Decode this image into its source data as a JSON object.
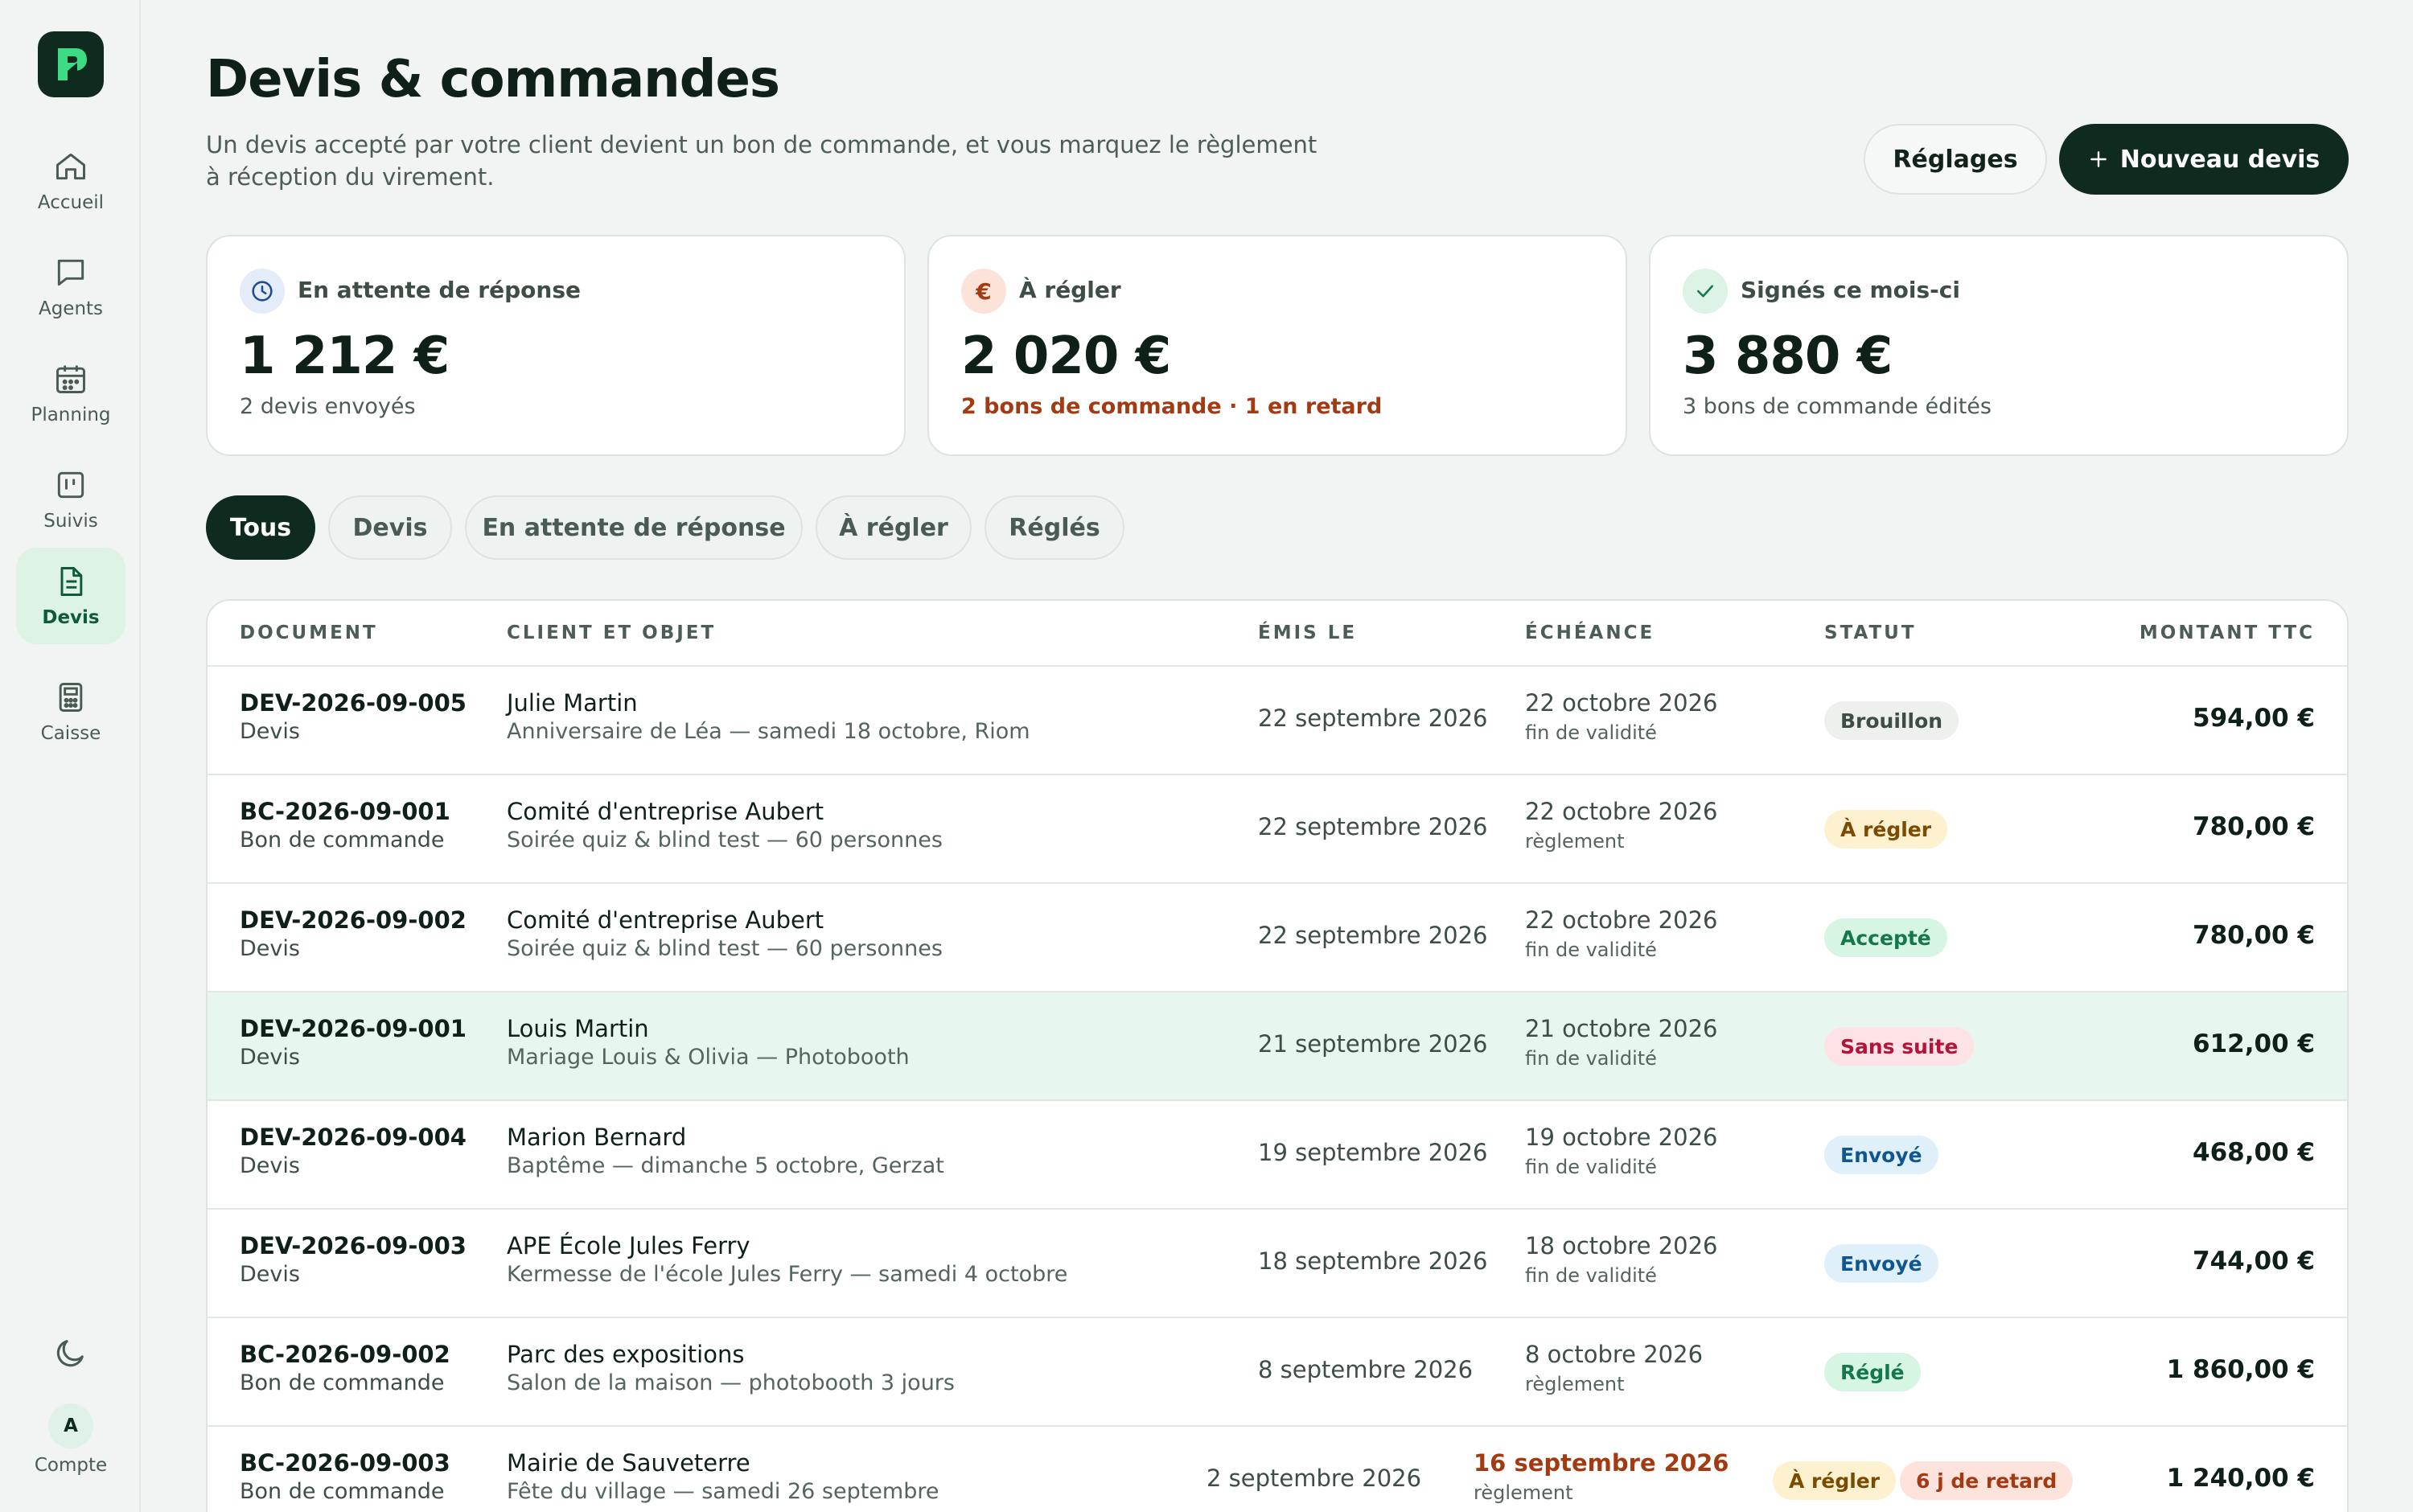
{
  "sidebar": {
    "items": [
      {
        "label": "Accueil",
        "icon": "home-icon"
      },
      {
        "label": "Agents",
        "icon": "chat-icon"
      },
      {
        "label": "Planning",
        "icon": "calendar-icon"
      },
      {
        "label": "Suivis",
        "icon": "kanban-icon"
      },
      {
        "label": "Devis",
        "icon": "document-icon",
        "active": true
      },
      {
        "label": "Caisse",
        "icon": "calculator-icon"
      }
    ],
    "account_initial": "A",
    "account_label": "Compte"
  },
  "header": {
    "title": "Devis & commandes",
    "subtitle": "Un devis accepté par votre client devient un bon de commande, et vous marquez le règlement à réception du virement.",
    "settings_label": "Réglages",
    "new_label": "Nouveau devis"
  },
  "cards": [
    {
      "label": "En attente de réponse",
      "value": "1 212 €",
      "note": "2 devis envoyés"
    },
    {
      "label": "À régler",
      "value": "2 020 €",
      "note": "2 bons de commande · 1 en retard"
    },
    {
      "label": "Signés ce mois-ci",
      "value": "3 880 €",
      "note": "3 bons de commande édités"
    }
  ],
  "filters": [
    "Tous",
    "Devis",
    "En attente de réponse",
    "À régler",
    "Réglés"
  ],
  "table": {
    "headers": [
      "DOCUMENT",
      "CLIENT ET OBJET",
      "ÉMIS LE",
      "ÉCHÉANCE",
      "STATUT",
      "MONTANT TTC"
    ],
    "rows": [
      {
        "id": "DEV-2026-09-005",
        "type": "Devis",
        "client": "Julie Martin",
        "object": "Anniversaire de Léa — samedi 18 octobre, Riom",
        "issued": "22 septembre 2026",
        "due": "22 octobre 2026",
        "due_note": "fin de validité",
        "status": "Brouillon",
        "amount": "594,00 €"
      },
      {
        "id": "BC-2026-09-001",
        "type": "Bon de commande",
        "client": "Comité d'entreprise Aubert",
        "object": "Soirée quiz & blind test — 60 personnes",
        "issued": "22 septembre 2026",
        "due": "22 octobre 2026",
        "due_note": "règlement",
        "status": "À régler",
        "amount": "780,00 €"
      },
      {
        "id": "DEV-2026-09-002",
        "type": "Devis",
        "client": "Comité d'entreprise Aubert",
        "object": "Soirée quiz & blind test — 60 personnes",
        "issued": "22 septembre 2026",
        "due": "22 octobre 2026",
        "due_note": "fin de validité",
        "status": "Accepté",
        "amount": "780,00 €"
      },
      {
        "id": "DEV-2026-09-001",
        "type": "Devis",
        "client": "Louis Martin",
        "object": "Mariage Louis & Olivia — Photobooth",
        "issued": "21 septembre 2026",
        "due": "21 octobre 2026",
        "due_note": "fin de validité",
        "status": "Sans suite",
        "amount": "612,00 €"
      },
      {
        "id": "DEV-2026-09-004",
        "type": "Devis",
        "client": "Marion Bernard",
        "object": "Baptême — dimanche 5 octobre, Gerzat",
        "issued": "19 septembre 2026",
        "due": "19 octobre 2026",
        "due_note": "fin de validité",
        "status": "Envoyé",
        "amount": "468,00 €"
      },
      {
        "id": "DEV-2026-09-003",
        "type": "Devis",
        "client": "APE École Jules Ferry",
        "object": "Kermesse de l'école Jules Ferry — samedi 4 octobre",
        "issued": "18 septembre 2026",
        "due": "18 octobre 2026",
        "due_note": "fin de validité",
        "status": "Envoyé",
        "amount": "744,00 €"
      },
      {
        "id": "BC-2026-09-002",
        "type": "Bon de commande",
        "client": "Parc des expositions",
        "object": "Salon de la maison — photobooth 3 jours",
        "issued": "8 septembre 2026",
        "due": "8 octobre 2026",
        "due_note": "règlement",
        "status": "Réglé",
        "amount": "1 860,00 €"
      },
      {
        "id": "BC-2026-09-003",
        "type": "Bon de commande",
        "client": "Mairie de Sauveterre",
        "object": "Fête du village — samedi 26 septembre",
        "issued": "2 septembre 2026",
        "due": "16 septembre 2026",
        "due_note": "règlement",
        "status": "À régler",
        "late": "6 j de retard",
        "amount": "1 240,00 €"
      }
    ]
  },
  "colors": {
    "brand": "#0f2b20",
    "accent_green": "#3ddc84",
    "overdue": "#a33a12",
    "highlight_row": "#e7f6ee"
  }
}
